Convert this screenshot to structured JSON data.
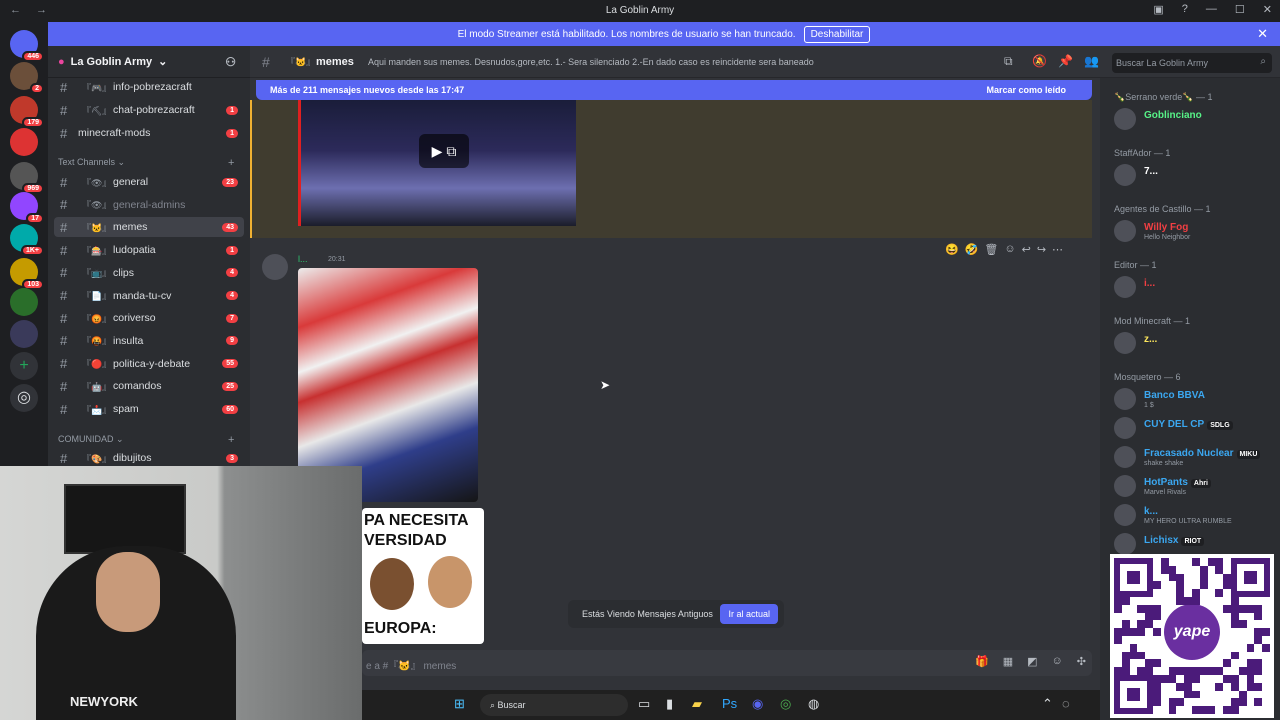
{
  "window": {
    "title": "La Goblin Army"
  },
  "banner": {
    "text": "El modo Streamer está habilitado. Los nombres de usuario se han truncado.",
    "button": "Deshabilitar"
  },
  "servers": [
    {
      "badge": "446",
      "color": "#5865f2"
    },
    {
      "badge": "2",
      "color": "#6b4f3a"
    },
    {
      "badge": "179",
      "color": "#c0392b"
    },
    {
      "badge": "",
      "color": "#d33"
    },
    {
      "badge": "969",
      "color": "#555"
    },
    {
      "badge": "17",
      "color": "#9146ff"
    },
    {
      "badge": "1K+",
      "color": "#0aa"
    },
    {
      "badge": "103",
      "color": "#c59b00"
    },
    {
      "badge": "",
      "color": "#2a6e2a"
    },
    {
      "badge": "",
      "color": "#3a3a5a"
    }
  ],
  "sidebar": {
    "guild_name": "La Goblin Army",
    "channels_top": [
      {
        "emoji": "『🎮』",
        "name": "info-pobrezacraft",
        "count": ""
      },
      {
        "emoji": "『⛏』",
        "name": "chat-pobrezacraft",
        "count": "1"
      },
      {
        "emoji": "",
        "name": "minecraft-mods",
        "count": "1"
      }
    ],
    "category_text": "Text Channels",
    "channels": [
      {
        "emoji": "『👁』",
        "name": "general",
        "count": "23"
      },
      {
        "emoji": "『👁』",
        "name": "general-admins",
        "count": ""
      },
      {
        "emoji": "『🐱』",
        "name": "memes",
        "count": "43"
      },
      {
        "emoji": "『🎰』",
        "name": "ludopatia",
        "count": "1"
      },
      {
        "emoji": "『📺』",
        "name": "clips",
        "count": "4"
      },
      {
        "emoji": "『📄』",
        "name": "manda-tu-cv",
        "count": "4"
      },
      {
        "emoji": "『😡』",
        "name": "coriverso",
        "count": "7"
      },
      {
        "emoji": "『🤬』",
        "name": "insulta",
        "count": "9"
      },
      {
        "emoji": "『🔴』",
        "name": "politica-y-debate",
        "count": "55"
      },
      {
        "emoji": "『🤖』",
        "name": "comandos",
        "count": "25"
      },
      {
        "emoji": "『📩』",
        "name": "spam",
        "count": "60"
      }
    ],
    "category_community": "COMUNIDAD",
    "channels_community": [
      {
        "emoji": "『🎨』",
        "name": "dibujitos",
        "count": "3"
      }
    ]
  },
  "header": {
    "emoji": "『🐱』",
    "channel": "memes",
    "topic": "Aqui manden sus memes. Desnudos,gore,etc. 1.- Sera silenciado 2.-En dado caso es reincidente sera baneado",
    "search_placeholder": "Buscar La Goblin Army"
  },
  "new_messages": {
    "text": "Más de 211 mensajes nuevos desde las 17:47",
    "mark_read": "Marcar como leído"
  },
  "message": {
    "author": "l...",
    "time": "20:31"
  },
  "meme": {
    "line1": "PA NECESITA",
    "line2": "VERSIDAD",
    "line3": "EUROPA:"
  },
  "old_messages": {
    "text": "Estás Viendo Mensajes Antiguos",
    "button": "Ir al actual"
  },
  "composer": {
    "placeholder": "e a #『🐱』 memes"
  },
  "taskbar": {
    "search": "Buscar"
  },
  "members": [
    {
      "category": "🍾Serrano verde🍾 — 1",
      "users": [
        {
          "name": "Goblinciano",
          "status": "",
          "color": "#57f287"
        }
      ]
    },
    {
      "category": "StaffAdor — 1",
      "users": [
        {
          "name": "7...",
          "status": "",
          "color": "#ffffff"
        }
      ]
    },
    {
      "category": "Agentes de Castillo — 1",
      "users": [
        {
          "name": "Willy Fog",
          "status": "Hello Neighbor",
          "color": "#f23f43"
        }
      ]
    },
    {
      "category": "Editor — 1",
      "users": [
        {
          "name": "i...",
          "status": "",
          "color": "#f23f43"
        }
      ]
    },
    {
      "category": "Mod Minecraft — 1",
      "users": [
        {
          "name": "z...",
          "status": "",
          "color": "#fee75c"
        }
      ]
    },
    {
      "category": "Mosquetero — 6",
      "users": [
        {
          "name": "Banco BBVA",
          "status": "1 $",
          "color": "#3ba7f0",
          "tag": ""
        },
        {
          "name": "CUY DEL CP",
          "status": "",
          "color": "#3ba7f0",
          "tag": "SDLG"
        },
        {
          "name": "Fracasado Nuclear",
          "status": "shake shake",
          "color": "#3ba7f0",
          "tag": "MIKU"
        },
        {
          "name": "HotPants",
          "status": "Marvel Rivals",
          "color": "#3ba7f0",
          "tag": "Ahri"
        },
        {
          "name": "k...",
          "status": "MY HERO ULTRA RUMBLE",
          "color": "#3ba7f0",
          "tag": ""
        },
        {
          "name": "Lichisx",
          "status": "",
          "color": "#3ba7f0",
          "tag": "RIOT"
        }
      ]
    }
  ],
  "webcam": {
    "hoodie_text": "NEWYORK"
  },
  "qr": {
    "brand": "yape"
  }
}
